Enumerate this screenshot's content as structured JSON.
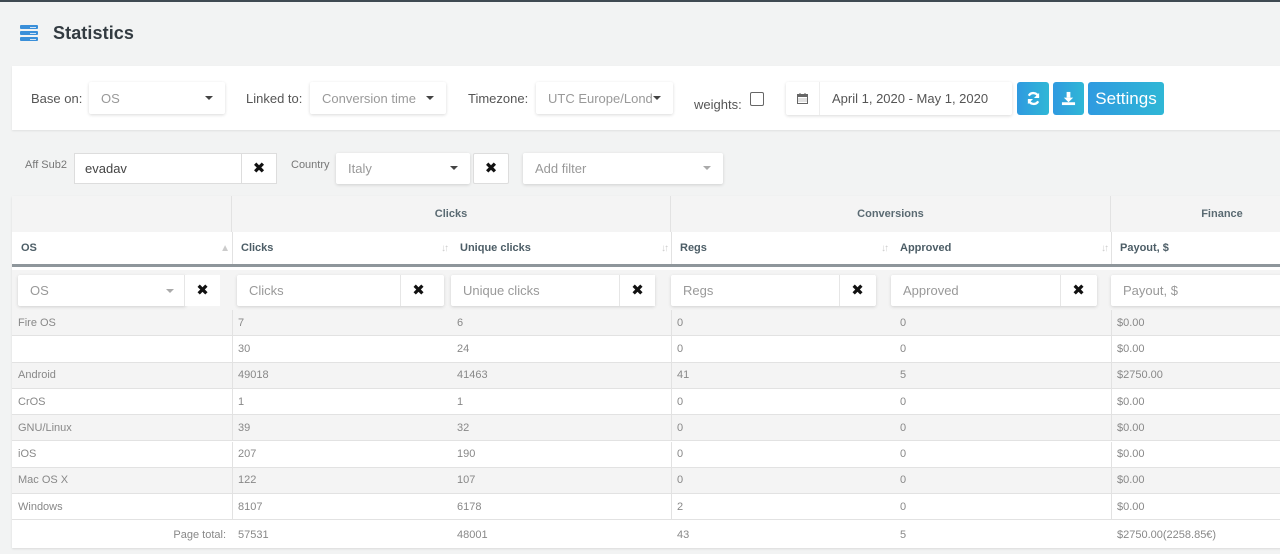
{
  "header": {
    "title": "Statistics",
    "icon": "server-list-icon"
  },
  "toolbar": {
    "base_on_label": "Base on:",
    "base_on_value": "OS",
    "linked_to_label": "Linked to:",
    "linked_to_value": "Conversion time",
    "timezone_label": "Timezone:",
    "timezone_value": "UTC Europe/Lond",
    "weights_label": "weights:",
    "weights_checked": false,
    "date_range": "April 1, 2020 - May 1, 2020",
    "refresh_icon": "refresh-icon",
    "download_icon": "download-icon",
    "settings_label": "Settings",
    "accent_color": "#2fa5dc"
  },
  "filters": {
    "aff_sub2_label": "Aff Sub2",
    "aff_sub2_value": "evadav",
    "country_label": "Country",
    "country_value": "Italy",
    "add_filter_placeholder": "Add filter",
    "clear_icon": "✖"
  },
  "table": {
    "groups": [
      {
        "label": ""
      },
      {
        "label": "Clicks"
      },
      {
        "label": "Conversions"
      },
      {
        "label": "Finance"
      }
    ],
    "columns": [
      {
        "label": "OS",
        "filter_placeholder": "OS"
      },
      {
        "label": "Clicks",
        "filter_placeholder": "Clicks"
      },
      {
        "label": "Unique clicks",
        "filter_placeholder": "Unique clicks"
      },
      {
        "label": "Regs",
        "filter_placeholder": "Regs"
      },
      {
        "label": "Approved",
        "filter_placeholder": "Approved"
      },
      {
        "label": "Payout, $",
        "filter_placeholder": "Payout, $"
      }
    ],
    "rows": [
      {
        "os": "Fire OS",
        "clicks": "7",
        "unique": "6",
        "regs": "0",
        "approved": "0",
        "payout": "$0.00"
      },
      {
        "os": "",
        "clicks": "30",
        "unique": "24",
        "regs": "0",
        "approved": "0",
        "payout": "$0.00"
      },
      {
        "os": "Android",
        "clicks": "49018",
        "unique": "41463",
        "regs": "41",
        "approved": "5",
        "payout": "$2750.00"
      },
      {
        "os": "CrOS",
        "clicks": "1",
        "unique": "1",
        "regs": "0",
        "approved": "0",
        "payout": "$0.00"
      },
      {
        "os": "GNU/Linux",
        "clicks": "39",
        "unique": "32",
        "regs": "0",
        "approved": "0",
        "payout": "$0.00"
      },
      {
        "os": "iOS",
        "clicks": "207",
        "unique": "190",
        "regs": "0",
        "approved": "0",
        "payout": "$0.00"
      },
      {
        "os": "Mac OS X",
        "clicks": "122",
        "unique": "107",
        "regs": "0",
        "approved": "0",
        "payout": "$0.00"
      },
      {
        "os": "Windows",
        "clicks": "8107",
        "unique": "6178",
        "regs": "2",
        "approved": "0",
        "payout": "$0.00"
      }
    ],
    "total": {
      "label": "Page total:",
      "clicks": "57531",
      "unique": "48001",
      "regs": "43",
      "approved": "5",
      "payout": "$2750.00(2258.85€)"
    }
  }
}
